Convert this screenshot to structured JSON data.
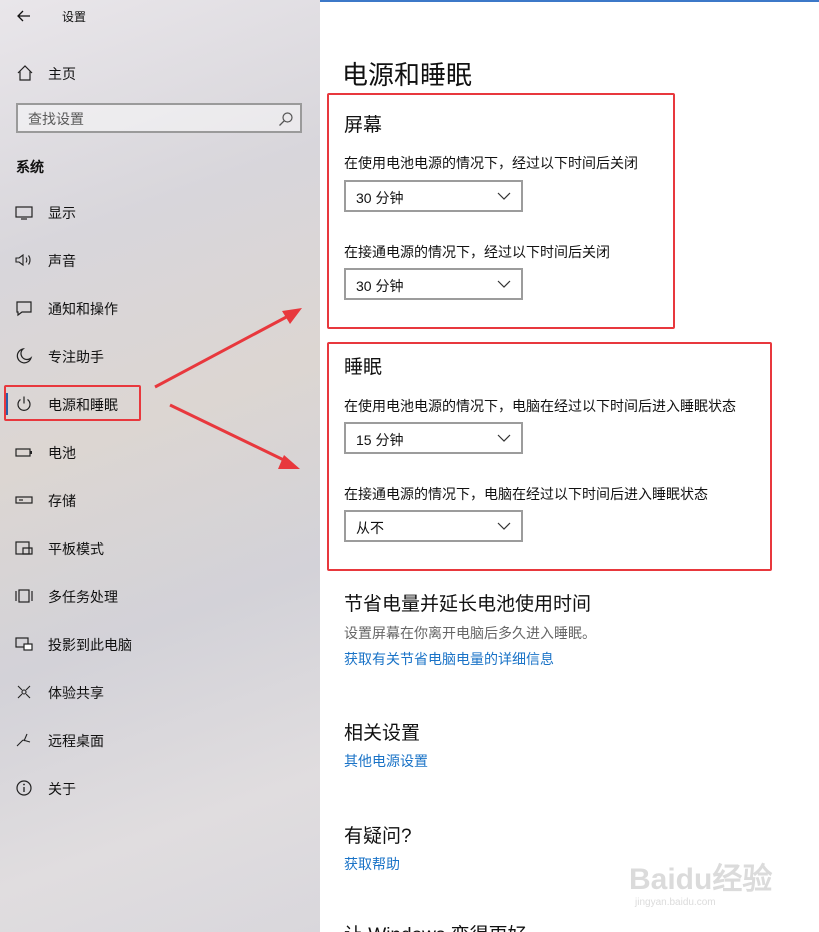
{
  "app": {
    "title": "设置",
    "back_icon": "back-arrow-icon"
  },
  "sidebar": {
    "home_label": "主页",
    "search_placeholder": "查找设置",
    "section_title": "系统",
    "items": [
      {
        "label": "显示",
        "icon": "display-icon"
      },
      {
        "label": "声音",
        "icon": "speaker-icon"
      },
      {
        "label": "通知和操作",
        "icon": "notification-icon"
      },
      {
        "label": "专注助手",
        "icon": "moon-icon"
      },
      {
        "label": "电源和睡眠",
        "icon": "power-icon",
        "selected": true
      },
      {
        "label": "电池",
        "icon": "battery-icon"
      },
      {
        "label": "存储",
        "icon": "storage-icon"
      },
      {
        "label": "平板模式",
        "icon": "tablet-icon"
      },
      {
        "label": "多任务处理",
        "icon": "multitask-icon"
      },
      {
        "label": "投影到此电脑",
        "icon": "project-icon"
      },
      {
        "label": "体验共享",
        "icon": "share-icon"
      },
      {
        "label": "远程桌面",
        "icon": "remote-desktop-icon"
      },
      {
        "label": "关于",
        "icon": "info-icon"
      }
    ]
  },
  "main": {
    "title": "电源和睡眠",
    "screen": {
      "heading": "屏幕",
      "battery_label": "在使用电池电源的情况下，经过以下时间后关闭",
      "battery_value": "30 分钟",
      "plugged_label": "在接通电源的情况下，经过以下时间后关闭",
      "plugged_value": "30 分钟"
    },
    "sleep": {
      "heading": "睡眠",
      "battery_label": "在使用电池电源的情况下，电脑在经过以下时间后进入睡眠状态",
      "battery_value": "15 分钟",
      "plugged_label": "在接通电源的情况下，电脑在经过以下时间后进入睡眠状态",
      "plugged_value": "从不"
    },
    "save_power": {
      "heading": "节省电量并延长电池使用时间",
      "description": "设置屏幕在你离开电脑后多久进入睡眠。",
      "link": "获取有关节省电脑电量的详细信息"
    },
    "related": {
      "heading": "相关设置",
      "link": "其他电源设置"
    },
    "questions": {
      "heading": "有疑问?",
      "link": "获取帮助"
    },
    "cutoff_heading": "让 Windows 变得更好"
  },
  "annotation_color": "#e8383d",
  "accent_color": "#1a73c7",
  "watermark": {
    "text": "Baidu经验",
    "sub": "jingyan.baidu.com"
  }
}
